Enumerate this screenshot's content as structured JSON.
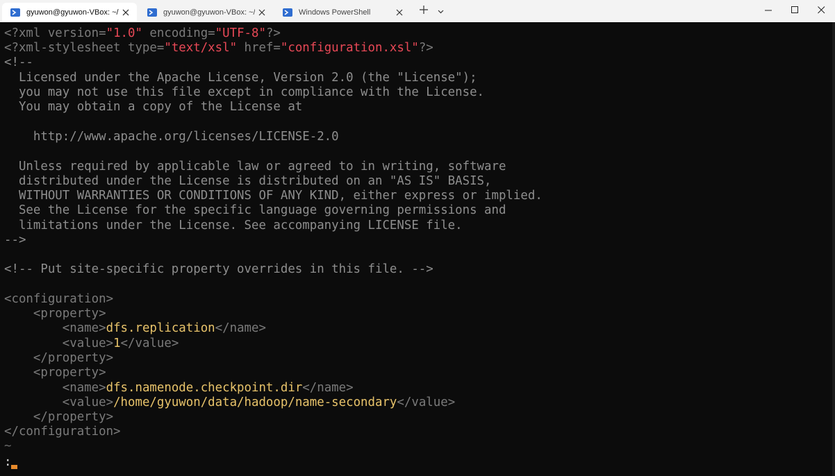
{
  "tabs": [
    {
      "label": "gyuwon@gyuwon-VBox: ~/h",
      "active": true
    },
    {
      "label": "gyuwon@gyuwon-VBox: ~/da",
      "active": false
    },
    {
      "label": "Windows PowerShell",
      "active": false
    }
  ],
  "icons": {
    "tab": "terminal-icon",
    "close": "close-icon",
    "new_tab": "plus-icon",
    "dropdown": "chevron-down-icon",
    "minimize": "minimize-icon",
    "maximize": "maximize-icon",
    "window_close": "window-close-icon"
  },
  "colors": {
    "tag": "#7a7a7a",
    "value": "#e8c36a",
    "string": "#e74856",
    "comment": "#8e8e8e",
    "cursor": "#e78a2b"
  },
  "terminal": {
    "l01": {
      "a": "<?xml version=",
      "b": "\"1.0\"",
      "c": " encoding=",
      "d": "\"UTF-8\"",
      "e": "?>"
    },
    "l02": {
      "a": "<?xml-stylesheet type=",
      "b": "\"text/xsl\"",
      "c": " href=",
      "d": "\"configuration.xsl\"",
      "e": "?>"
    },
    "l03": "<!--",
    "l04": "  Licensed under the Apache License, Version 2.0 (the \"License\");",
    "l05": "  you may not use this file except in compliance with the License.",
    "l06": "  You may obtain a copy of the License at",
    "l07": "    http://www.apache.org/licenses/LICENSE-2.0",
    "l08": "  Unless required by applicable law or agreed to in writing, software",
    "l09": "  distributed under the License is distributed on an \"AS IS\" BASIS,",
    "l10": "  WITHOUT WARRANTIES OR CONDITIONS OF ANY KIND, either express or implied.",
    "l11": "  See the License for the specific language governing permissions and",
    "l12": "  limitations under the License. See accompanying LICENSE file.",
    "l13": "-->",
    "l14": "<!-- Put site-specific property overrides in this file. -->",
    "l15": "<configuration>",
    "l16": "    <property>",
    "l17": {
      "a": "        <name>",
      "b": "dfs.replication",
      "c": "</name>"
    },
    "l18": {
      "a": "        <value>",
      "b": "1",
      "c": "</value>"
    },
    "l19": "    </property>",
    "l20": "    <property>",
    "l21": {
      "a": "        <name>",
      "b": "dfs.namenode.checkpoint.dir",
      "c": "</name>"
    },
    "l22": {
      "a": "        <value>",
      "b": "/home/gyuwon/data/hadoop/name-secondary",
      "c": "</value>"
    },
    "l23": "    </property>",
    "l24": "</configuration>",
    "l25": "~",
    "l26": ":"
  }
}
